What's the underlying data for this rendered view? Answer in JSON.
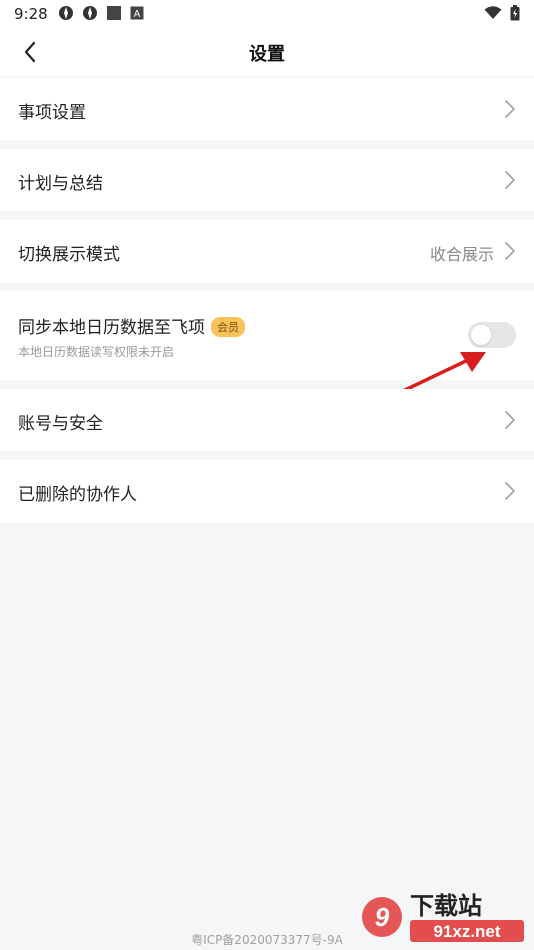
{
  "status_bar": {
    "time": "9:28",
    "left_icons": [
      "app-icon",
      "app-icon",
      "square-icon",
      "a-box-icon"
    ],
    "right_icons": [
      "wifi-icon",
      "battery-icon"
    ]
  },
  "nav": {
    "back_icon": "chevron-left-icon",
    "title": "设置"
  },
  "rows": {
    "item_settings": {
      "label": "事项设置"
    },
    "plan_summary": {
      "label": "计划与总结"
    },
    "display_mode": {
      "label": "切换展示模式",
      "value": "收合展示"
    },
    "sync_calendar": {
      "label": "同步本地日历数据至飞项",
      "badge": "会员",
      "sub": "本地日历数据读写权限未开启",
      "toggle_on": false
    },
    "account_security": {
      "label": "账号与安全"
    },
    "deleted_collaborators": {
      "label": "已删除的协作人"
    }
  },
  "footer": {
    "icp": "粤ICP备2020073377号-9A"
  },
  "watermark": {
    "logo_text": "下载站",
    "site_text": "91xz.net"
  },
  "colors": {
    "background": "#f5f6f8",
    "card": "#ffffff",
    "badge": "#f9c25a",
    "annotation_arrow": "#d81e1e"
  }
}
